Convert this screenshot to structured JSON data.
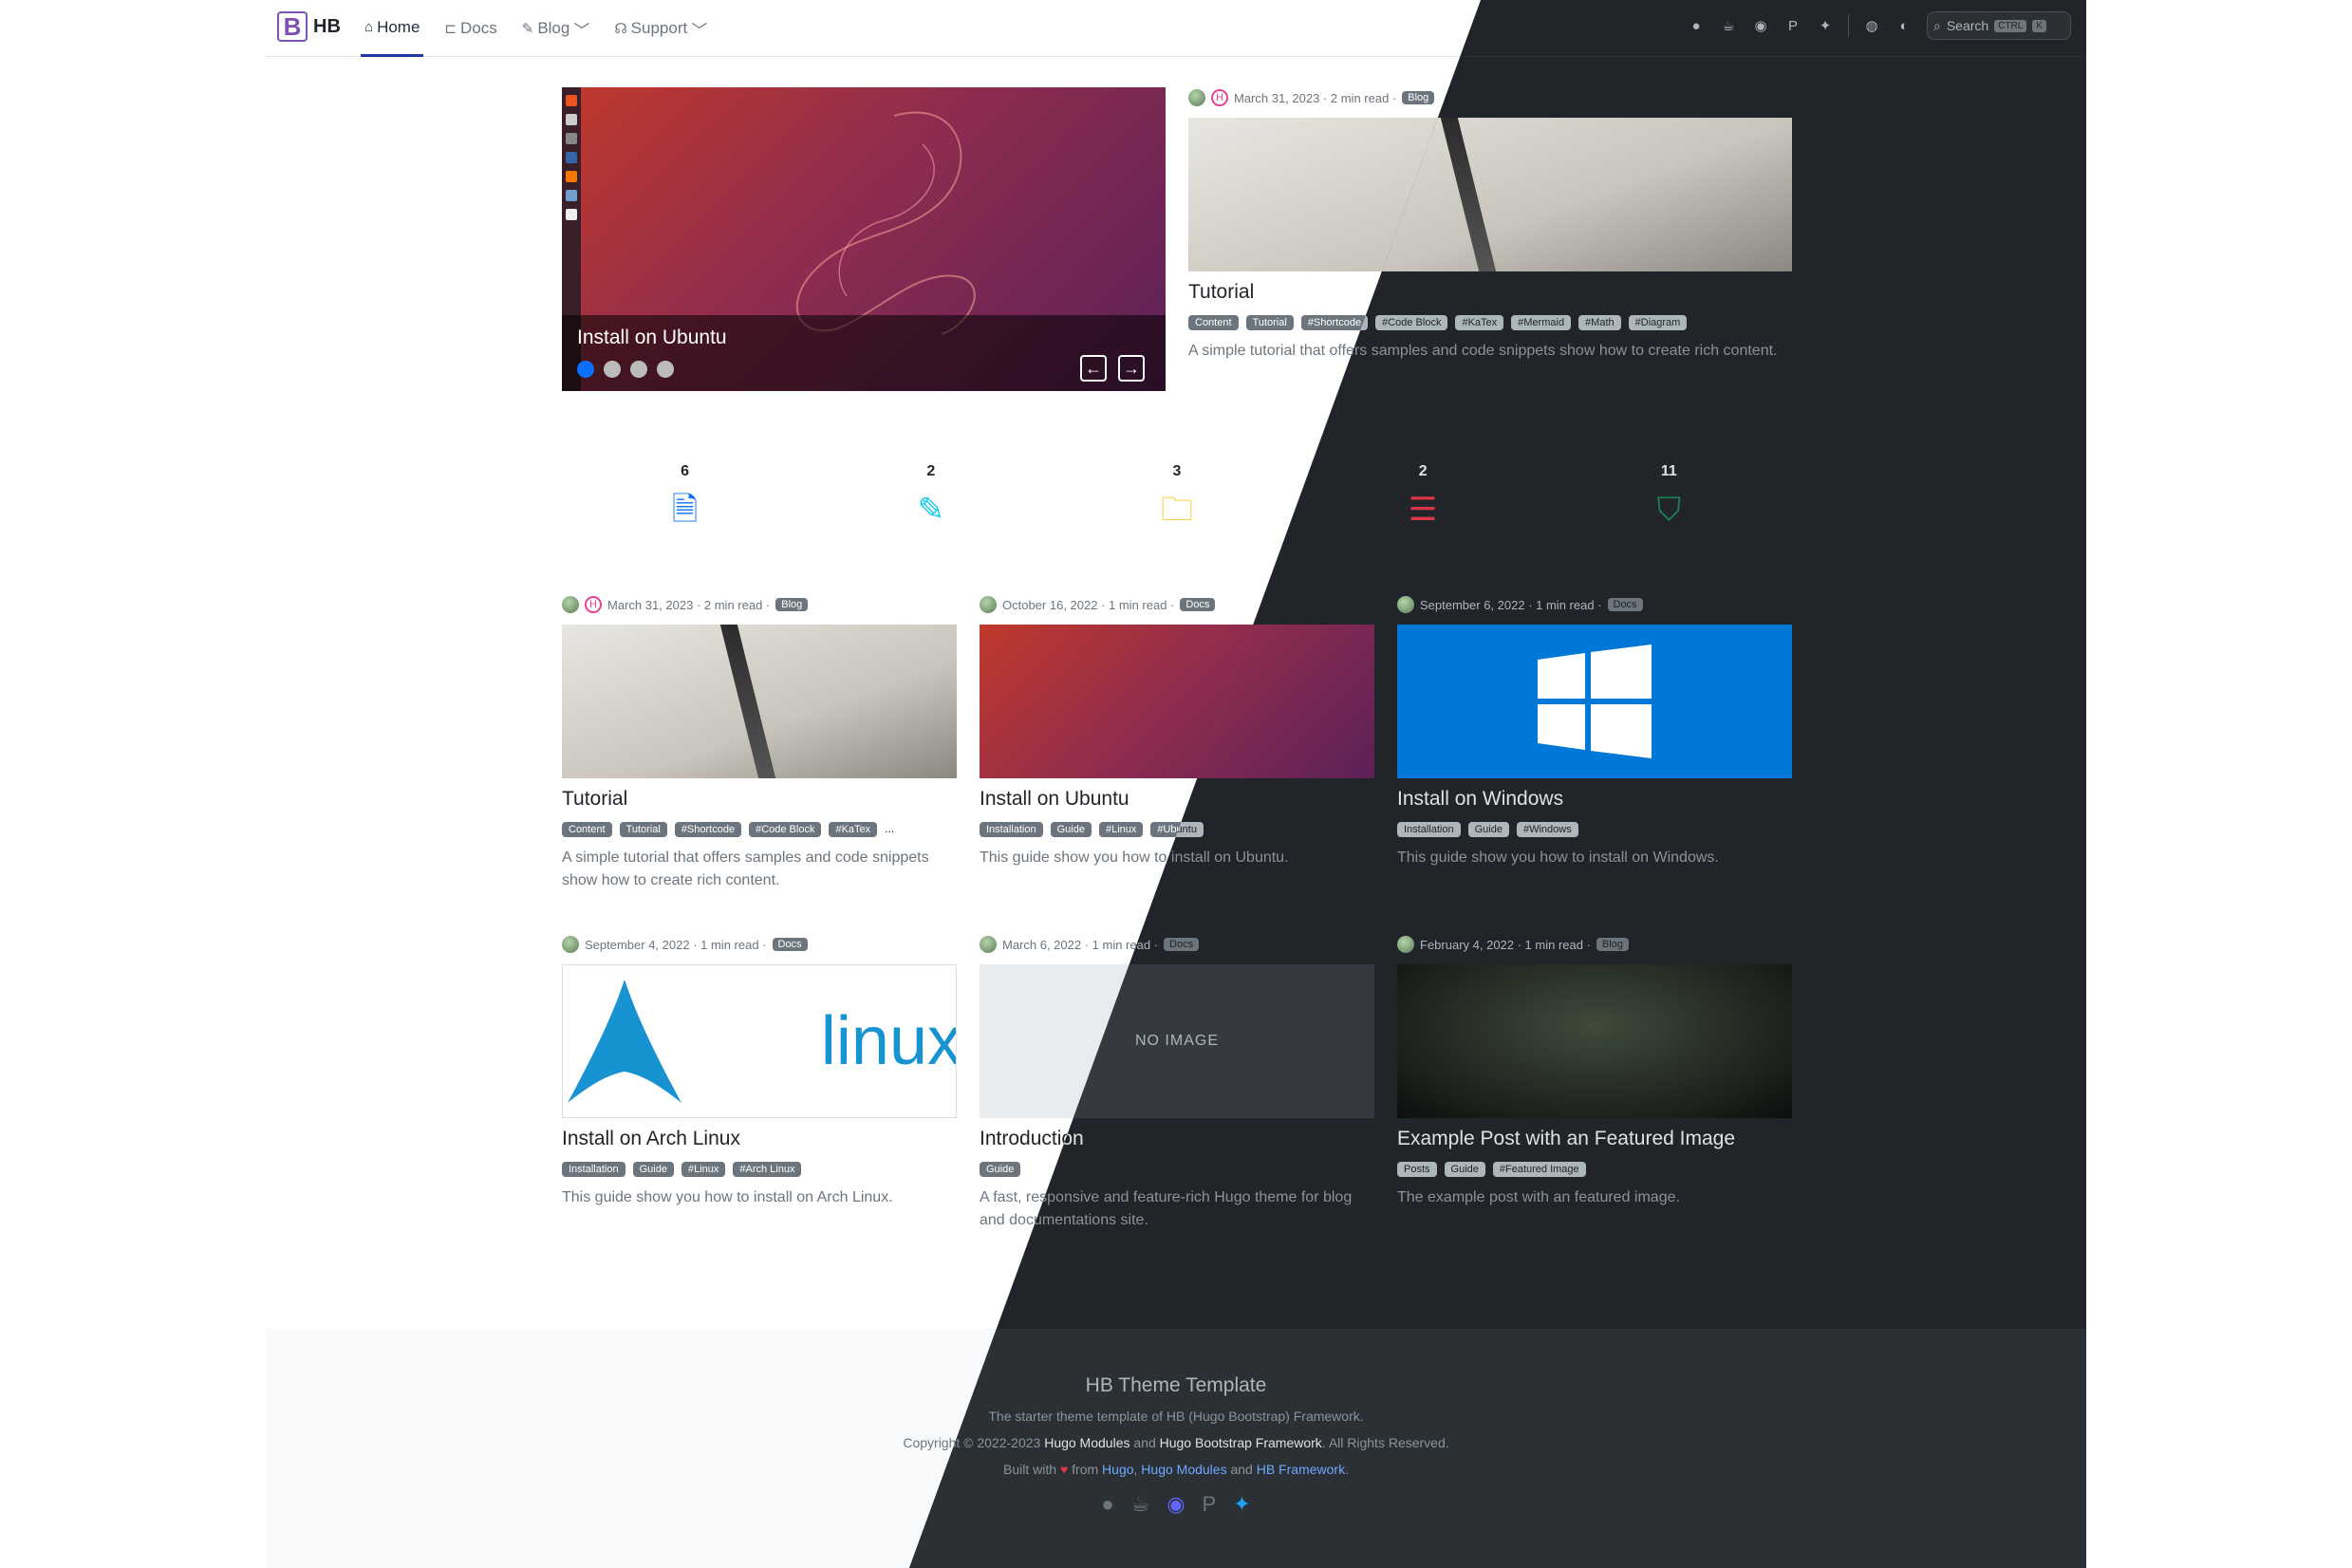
{
  "brand": {
    "logo": "B",
    "name": "HB"
  },
  "nav": [
    {
      "label": "Home",
      "icon": "home-icon",
      "active": true
    },
    {
      "label": "Docs",
      "icon": "book-icon"
    },
    {
      "label": "Blog",
      "icon": "blog-icon",
      "caret": "﹀"
    },
    {
      "label": "Support",
      "icon": "support-icon",
      "caret": "﹀"
    }
  ],
  "search": {
    "placeholder": "Search",
    "kbd1": "CTRL",
    "kbd2": "K"
  },
  "hero": {
    "carousel_title": "Install on Ubuntu",
    "prev": "←",
    "next": "→",
    "featured": {
      "date": "March 31, 2023 · 2 min read ·",
      "badge": "Blog",
      "title": "Tutorial",
      "tags": [
        "Content",
        "Tutorial",
        "#Shortcode",
        "#Code Block",
        "#KaTex",
        "#Mermaid",
        "#Math",
        "#Diagram"
      ],
      "desc": "A simple tutorial that offers samples and code snippets show how to create rich content."
    }
  },
  "stats": [
    {
      "count": "6",
      "icon": "📄",
      "color": "#0d6efd"
    },
    {
      "count": "2",
      "icon": "✎",
      "color": "#0dcaf0"
    },
    {
      "count": "3",
      "icon": "📁",
      "color": "#ffc107"
    },
    {
      "count": "2",
      "icon": "☰",
      "color": "#dc3545"
    },
    {
      "count": "11",
      "icon": "🏷",
      "color": "#198754"
    }
  ],
  "cards": [
    {
      "date": "March 31, 2023 · 2 min read ·",
      "badge": "Blog",
      "title": "Tutorial",
      "tags": [
        "Content",
        "Tutorial",
        "#Shortcode",
        "#Code Block",
        "#KaTex",
        "..."
      ],
      "desc": "A simple tutorial that offers samples and code snippets show how to create rich content."
    },
    {
      "date": "October 16, 2022 · 1 min read ·",
      "badge": "Docs",
      "title": "Install on Ubuntu",
      "tags": [
        "Installation",
        "Guide",
        "#Linux",
        "#Ubuntu"
      ],
      "desc": "This guide show you how to install on Ubuntu."
    },
    {
      "date": "September 6, 2022 · 1 min read ·",
      "badge": "Docs",
      "title": "Install on Windows",
      "tags": [
        "Installation",
        "Guide",
        "#Windows"
      ],
      "desc": "This guide show you how to install on Windows."
    },
    {
      "date": "September 4, 2022 · 1 min read ·",
      "badge": "Docs",
      "title": "Install on Arch Linux",
      "tags": [
        "Installation",
        "Guide",
        "#Linux",
        "#Arch Linux"
      ],
      "desc": "This guide show you how to install on Arch Linux.",
      "image_text": "linux"
    },
    {
      "date": "March 6, 2022 · 1 min read ·",
      "badge": "Docs",
      "title": "Introduction",
      "tags": [
        "Guide"
      ],
      "desc": "A fast, responsive and feature-rich Hugo theme for blog and documentations site.",
      "image_text": "NO IMAGE"
    },
    {
      "date": "February 4, 2022 · 1 min read ·",
      "badge": "Blog",
      "title": "Example Post with an Featured Image",
      "tags": [
        "Posts",
        "Guide",
        "#Featured Image"
      ],
      "desc": "The example post with an featured image."
    }
  ],
  "footer": {
    "title": "HB Theme Template",
    "tagline": "The starter theme template of HB (Hugo Bootstrap) Framework.",
    "copyright_prefix": "Copyright © 2022-2023 ",
    "copyright_l1": "Hugo Modules",
    "copyright_and": " and ",
    "copyright_l2": "Hugo Bootstrap Framework",
    "copyright_suffix": ". All Rights Reserved.",
    "built_prefix": "Built with ",
    "built_heart": "♥",
    "built_from": " from ",
    "built_l1": "Hugo",
    "built_comma": ", ",
    "built_l2": "Hugo Modules",
    "built_and": " and ",
    "built_l3": "HB Framework",
    "built_end": "."
  }
}
